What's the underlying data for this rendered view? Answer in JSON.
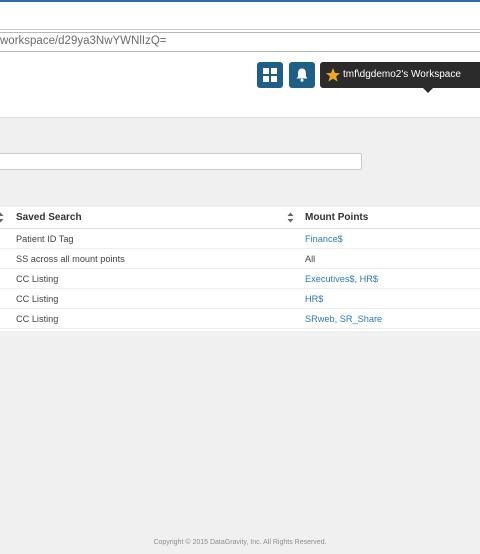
{
  "browser": {
    "url": "workspace/d29ya3NwYWNlIzQ="
  },
  "header": {
    "workspace_label": "tmf\\dgdemo2's Workspace"
  },
  "table": {
    "columns": {
      "saved_search": "Saved Search",
      "mount_points": "Mount Points"
    },
    "rows": [
      {
        "saved_search": "Patient ID Tag",
        "mount_points": "Finance$",
        "mount_link": true
      },
      {
        "saved_search": "SS across all mount points",
        "mount_points": "All",
        "mount_link": false
      },
      {
        "saved_search": "CC Listing",
        "mount_points": "Executives$, HR$",
        "mount_link": true
      },
      {
        "saved_search": "CC Listing",
        "mount_points": "HR$",
        "mount_link": true
      },
      {
        "saved_search": "CC Listing",
        "mount_points": "SRweb, SR_Share",
        "mount_link": true
      }
    ]
  },
  "footer": {
    "copyright": "Copyright © 2015 DataGravity, Inc. All Rights Reserved."
  },
  "colors": {
    "header_button": "#1f5f87",
    "workspace_pill": "#2b2b2b",
    "star": "#f0a81c",
    "link": "#2a7ab8"
  },
  "icons": [
    "grid-icon",
    "bell-icon",
    "star-icon",
    "sort-icon"
  ]
}
